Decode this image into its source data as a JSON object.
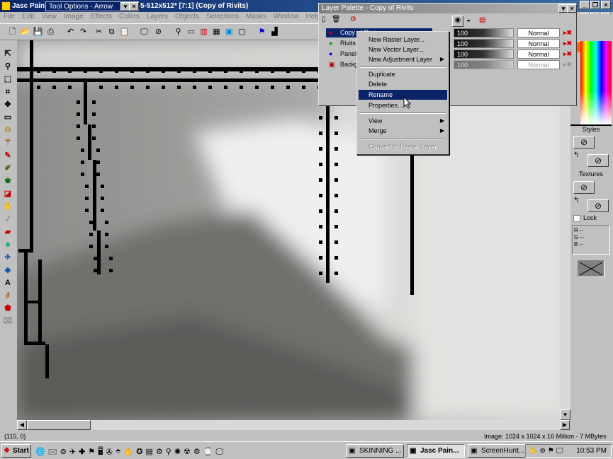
{
  "app": {
    "title": "Jasc Pain",
    "doc_title": "5-512x512* [7:1] (Copy of Rivits)",
    "tool_options_tab": "Tool Options - Arrow"
  },
  "menubar": [
    "File",
    "Edit",
    "View",
    "Image",
    "Effects",
    "Colors",
    "Layers",
    "Objects",
    "Selections",
    "Masks",
    "Window",
    "Help"
  ],
  "layer_palette": {
    "title": "Layer Palette - Copy of Rivits",
    "layers": [
      {
        "name": "Copy of Rivits",
        "opacity": "100",
        "blend": "Normal",
        "selected": true
      },
      {
        "name": "Rivits",
        "opacity": "100",
        "blend": "Normal"
      },
      {
        "name": "Panel",
        "opacity": "100",
        "blend": "Normal"
      },
      {
        "name": "Background",
        "opacity": "100",
        "blend": "Normal"
      }
    ]
  },
  "context_menu": {
    "items": [
      {
        "label": "New Raster Layer..."
      },
      {
        "label": "New Vector Layer..."
      },
      {
        "label": "New Adjustment Layer",
        "submenu": true
      },
      {
        "separator": true
      },
      {
        "label": "Duplicate"
      },
      {
        "label": "Delete"
      },
      {
        "label": "Rename",
        "highlighted": true
      },
      {
        "label": "Properties..."
      },
      {
        "separator": true
      },
      {
        "label": "View",
        "submenu": true
      },
      {
        "label": "Merge",
        "submenu": true
      },
      {
        "separator": true
      },
      {
        "label": "Convert to Raster Layer",
        "disabled": true
      }
    ]
  },
  "right_palette": {
    "styles_label": "Styles",
    "textures_label": "Textures",
    "lock_label": "Lock",
    "r_label": "R",
    "g_label": "G",
    "b_label": "B",
    "r_value": "--",
    "g_value": "--",
    "b_value": "--"
  },
  "status": {
    "coords": "(115, 0)",
    "image_info": "Image: 1024 x 1024 x 16 Million - 7 MBytes"
  },
  "taskbar": {
    "start_label": "Start",
    "buttons": [
      "SKINNING ...",
      "Jasc Pain...",
      "ScreenHunt..."
    ],
    "clock": "10:53 PM"
  },
  "colors": {
    "titlebar": "#0a246a",
    "highlight": "#0a246a",
    "face": "#c0c0c0"
  }
}
